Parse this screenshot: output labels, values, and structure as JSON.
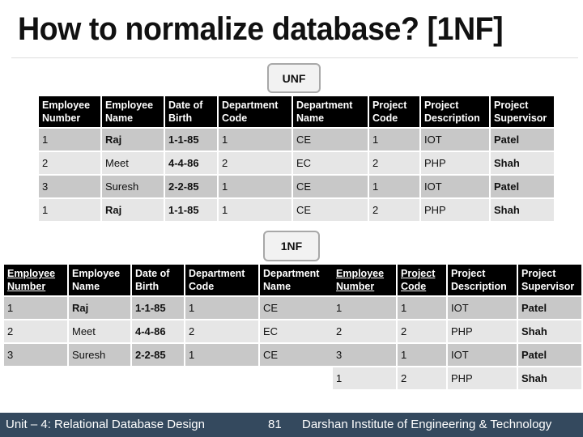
{
  "title": "How to normalize database? [1NF]",
  "unf": {
    "label": "UNF",
    "headers": [
      [
        "Employee",
        "Number"
      ],
      [
        "Employee",
        "Name"
      ],
      [
        "Date of",
        "Birth"
      ],
      [
        "Department",
        "Code"
      ],
      [
        "Department",
        "Name"
      ],
      [
        "Project",
        "Code"
      ],
      [
        "Project",
        "Description"
      ],
      [
        "Project",
        "Supervisor"
      ]
    ],
    "rows": [
      [
        "1",
        "Raj",
        "1-1-85",
        "1",
        "CE",
        "1",
        "IOT",
        "Patel"
      ],
      [
        "2",
        "Meet",
        "4-4-86",
        "2",
        "EC",
        "2",
        "PHP",
        "Shah"
      ],
      [
        "3",
        "Suresh",
        "2-2-85",
        "1",
        "CE",
        "1",
        "IOT",
        "Patel"
      ],
      [
        "1",
        "Raj",
        "1-1-85",
        "1",
        "CE",
        "2",
        "PHP",
        "Shah"
      ]
    ]
  },
  "nf1": {
    "label": "1NF",
    "employee_table": {
      "headers": [
        [
          "Employee",
          "Number"
        ],
        [
          "Employee",
          "Name"
        ],
        [
          "Date of",
          "Birth"
        ],
        [
          "Department",
          "Code"
        ],
        [
          "Department",
          "Name"
        ]
      ],
      "key_columns": [
        0
      ],
      "rows": [
        [
          "1",
          "Raj",
          "1-1-85",
          "1",
          "CE"
        ],
        [
          "2",
          "Meet",
          "4-4-86",
          "2",
          "EC"
        ],
        [
          "3",
          "Suresh",
          "2-2-85",
          "1",
          "CE"
        ]
      ]
    },
    "project_table": {
      "headers": [
        [
          "Employee",
          "Number"
        ],
        [
          "Project",
          "Code"
        ],
        [
          "Project",
          "Description"
        ],
        [
          "Project",
          "Supervisor"
        ]
      ],
      "key_columns": [
        0,
        1
      ],
      "rows": [
        [
          "1",
          "1",
          "IOT",
          "Patel"
        ],
        [
          "2",
          "2",
          "PHP",
          "Shah"
        ],
        [
          "3",
          "1",
          "IOT",
          "Patel"
        ],
        [
          "1",
          "2",
          "PHP",
          "Shah"
        ]
      ]
    }
  },
  "footer": {
    "unit": "Unit – 4: Relational Database Design",
    "page": "81",
    "institute": "Darshan Institute of Engineering & Technology"
  }
}
